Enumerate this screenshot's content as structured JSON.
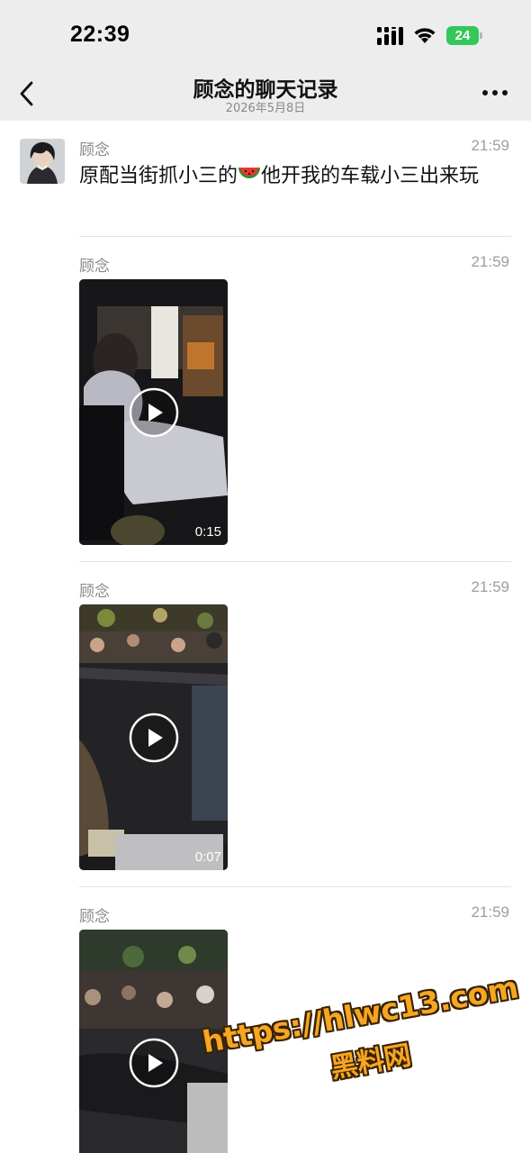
{
  "status_bar": {
    "time": "22:39",
    "battery_level": "24",
    "icons": [
      "signal-icon",
      "wifi-icon",
      "battery-icon"
    ]
  },
  "nav": {
    "title": "顾念的聊天记录",
    "subtitle": "2026年5月8日",
    "back_icon": "chevron-left-icon",
    "more_icon": "more-dots-icon"
  },
  "messages": [
    {
      "sender": "顾念",
      "time": "21:59",
      "type": "text",
      "text_before": "原配当街抓小三的",
      "emoji": "watermelon",
      "text_after": "他开我的车载小三出来玩"
    },
    {
      "sender": "顾念",
      "time": "21:59",
      "type": "video",
      "duration": "0:15"
    },
    {
      "sender": "顾念",
      "time": "21:59",
      "type": "video",
      "duration": "0:07"
    },
    {
      "sender": "顾念",
      "time": "21:59",
      "type": "video"
    }
  ],
  "watermark": {
    "url": "https://hlwc13.com",
    "name": "黑料网"
  },
  "colors": {
    "header_bg": "#ededed",
    "battery_green": "#34c759",
    "watermark": "#f5a623"
  }
}
